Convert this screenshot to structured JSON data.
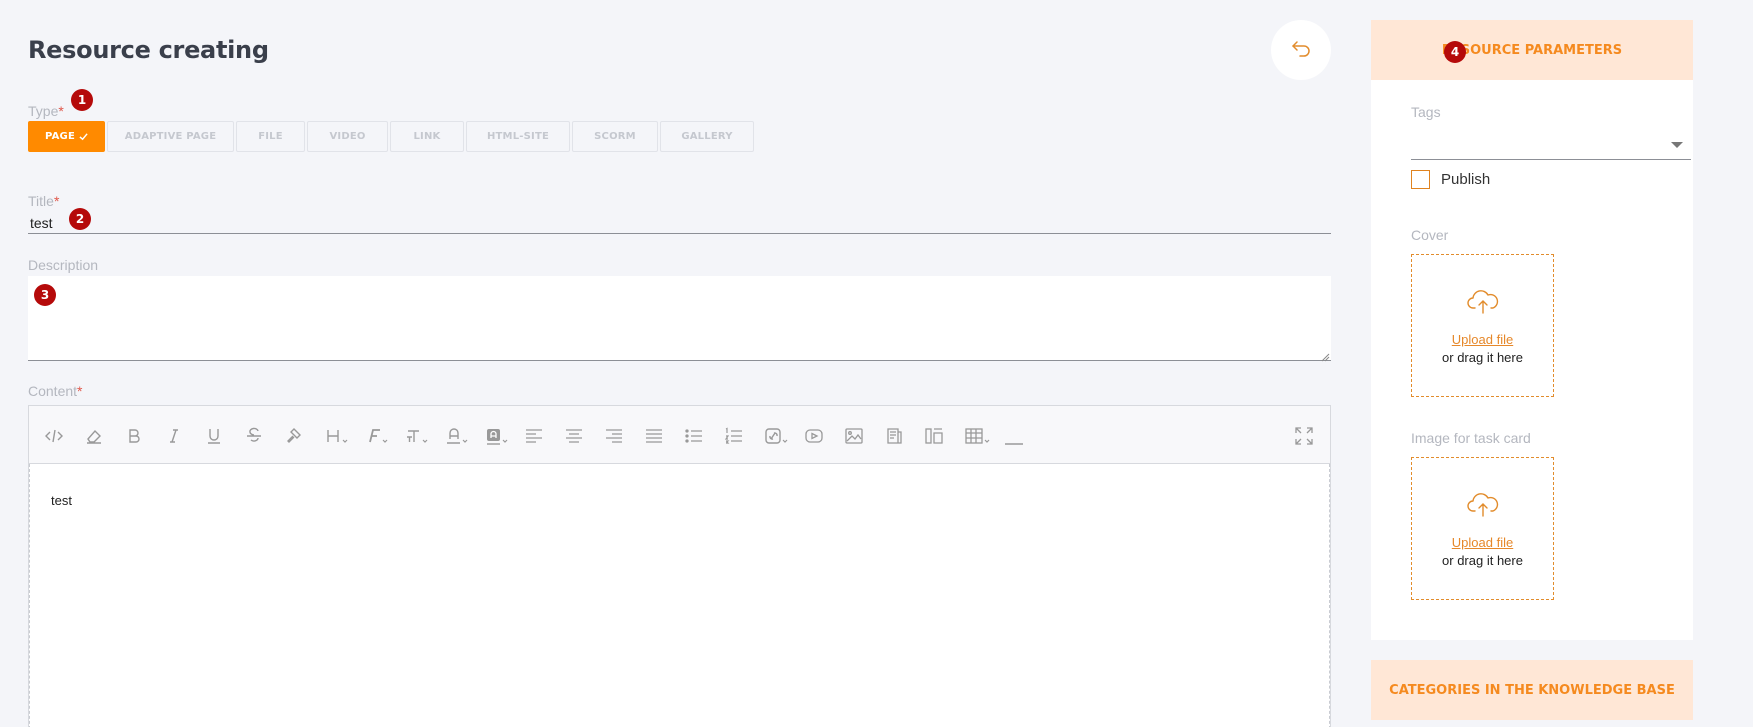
{
  "page": {
    "title": "Resource creating"
  },
  "markers": [
    "1",
    "2",
    "3",
    "4"
  ],
  "type_field": {
    "label": "Type",
    "required_mark": "*",
    "options": [
      {
        "label": "PAGE",
        "active": true
      },
      {
        "label": "ADAPTIVE PAGE",
        "active": false
      },
      {
        "label": "FILE",
        "active": false
      },
      {
        "label": "VIDEO",
        "active": false
      },
      {
        "label": "LINK",
        "active": false
      },
      {
        "label": "HTML-SITE",
        "active": false
      },
      {
        "label": "SCORM",
        "active": false
      },
      {
        "label": "GALLERY",
        "active": false
      }
    ]
  },
  "title_field": {
    "label": "Title",
    "required_mark": "*",
    "value": "test"
  },
  "description_field": {
    "label": "Description",
    "value": ""
  },
  "content_field": {
    "label": "Content",
    "required_mark": "*",
    "value": "test",
    "toolbar": [
      "code-view-icon",
      "eraser-icon",
      "bold-icon",
      "italic-icon",
      "underline-icon",
      "strikethrough-icon",
      "format-painter-icon",
      "heading-icon",
      "font-family-icon",
      "font-size-icon",
      "text-color-icon",
      "background-color-icon",
      "align-left-icon",
      "align-center-icon",
      "align-right-icon",
      "align-justify-icon",
      "bullet-list-icon",
      "numbered-list-icon",
      "link-icon",
      "video-icon",
      "image-icon",
      "file-icon",
      "layout-icon",
      "table-icon",
      "horizontal-line-icon",
      "fullscreen-icon"
    ]
  },
  "resource_parameters": {
    "header": "RESOURCE PARAMETERS",
    "tags_label": "Tags",
    "publish_label": "Publish",
    "publish_checked": false,
    "cover_label": "Cover",
    "task_card_label": "Image for task card",
    "upload_link": "Upload file",
    "upload_hint": "or drag it here"
  },
  "categories": {
    "header": "CATEGORIES IN THE KNOWLEDGE BASE"
  },
  "colors": {
    "accent": "#ff8a00",
    "marker": "#b50a0a",
    "header_bg": "#ffe7d6",
    "header_text": "#f58a1f"
  }
}
